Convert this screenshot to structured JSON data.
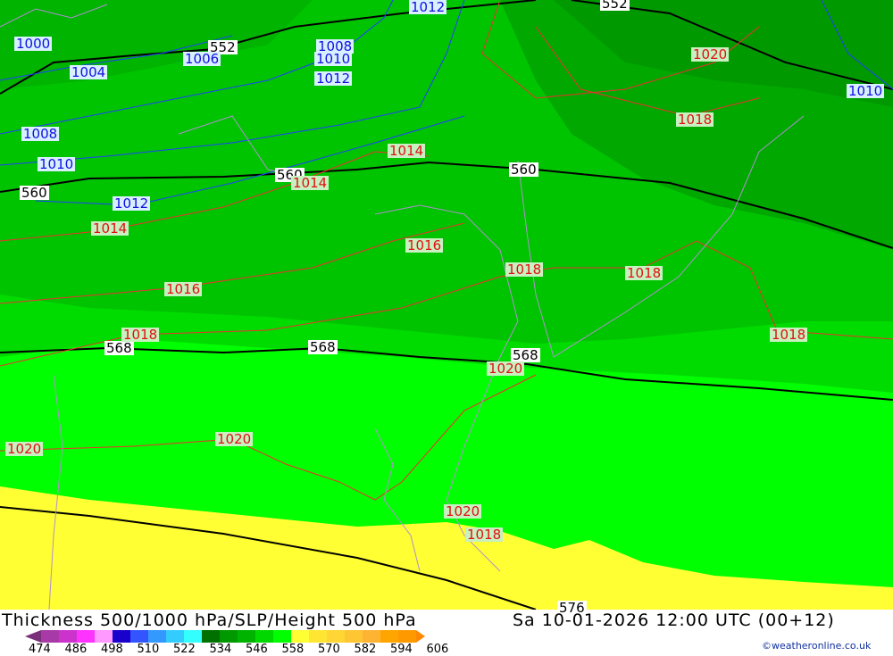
{
  "title": "Thickness 500/1000 hPa/SLP/Height 500 hPa",
  "datetime": "Sa 10-01-2026 12:00 UTC (00+12)",
  "copyright": "©weatheronline.co.uk",
  "colorbar": {
    "ticks": [
      "474",
      "486",
      "498",
      "510",
      "522",
      "534",
      "546",
      "558",
      "570",
      "582",
      "594",
      "606"
    ],
    "colors": [
      "#a83aa8",
      "#cc33cc",
      "#ff33ff",
      "#ff99ff",
      "#1a00cc",
      "#3355ff",
      "#3399ff",
      "#33ccff",
      "#33ffff",
      "#007000",
      "#009900",
      "#00b300",
      "#00d800",
      "#00ff00",
      "#ffff33",
      "#ffe633",
      "#ffd633",
      "#ffc633",
      "#ffb333",
      "#ffa500",
      "#ff9900"
    ],
    "low_arrow": "#7b2f7b",
    "high_arrow": "#ff8800"
  },
  "height_labels": [
    {
      "text": "552"
    },
    {
      "text": "552"
    },
    {
      "text": "560"
    },
    {
      "text": "560"
    },
    {
      "text": "560"
    },
    {
      "text": "568"
    },
    {
      "text": "568"
    },
    {
      "text": "568"
    },
    {
      "text": "576"
    }
  ],
  "isobar_labels": [
    {
      "text": "1012",
      "c": "b"
    },
    {
      "text": "1000",
      "c": "b"
    },
    {
      "text": "1004",
      "c": "b"
    },
    {
      "text": "1006",
      "c": "b"
    },
    {
      "text": "1008",
      "c": "b"
    },
    {
      "text": "1010",
      "c": "b"
    },
    {
      "text": "1012",
      "c": "b"
    },
    {
      "text": "1008",
      "c": "b"
    },
    {
      "text": "1010",
      "c": "b"
    },
    {
      "text": "1012",
      "c": "b"
    },
    {
      "text": "1010",
      "c": "b"
    },
    {
      "text": "1020",
      "c": "r"
    },
    {
      "text": "1018",
      "c": "r"
    },
    {
      "text": "1014",
      "c": "r"
    },
    {
      "text": "1014",
      "c": "r"
    },
    {
      "text": "1014",
      "c": "r"
    },
    {
      "text": "1016",
      "c": "r"
    },
    {
      "text": "1018",
      "c": "r"
    },
    {
      "text": "1018",
      "c": "r"
    },
    {
      "text": "1016",
      "c": "r"
    },
    {
      "text": "1018",
      "c": "r"
    },
    {
      "text": "1018",
      "c": "r"
    },
    {
      "text": "1020",
      "c": "r"
    },
    {
      "text": "1020",
      "c": "r"
    },
    {
      "text": "1020",
      "c": "r"
    },
    {
      "text": "1020",
      "c": "r"
    },
    {
      "text": "1018",
      "c": "r"
    }
  ]
}
